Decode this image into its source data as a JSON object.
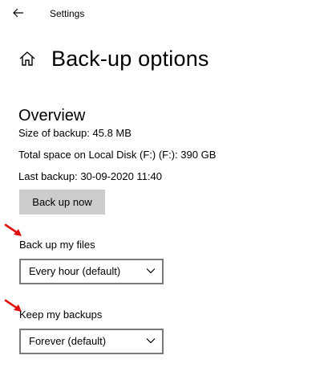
{
  "titlebar": {
    "app_title": "Settings",
    "back_icon": "arrow-left-icon"
  },
  "header": {
    "home_icon": "home-icon",
    "page_title": "Back-up options"
  },
  "overview": {
    "heading": "Overview",
    "size_of_backup": "Size of backup: 45.8 MB",
    "total_space": "Total space on Local Disk (F:) (F:): 390 GB",
    "last_backup": "Last backup: 30-09-2020 11:40",
    "back_up_now_label": "Back up now"
  },
  "backup_files": {
    "label": "Back up my files",
    "selected": "Every hour (default)"
  },
  "keep_backups": {
    "label": "Keep my backups",
    "selected": "Forever (default)"
  },
  "colors": {
    "button_bg": "#cccccc",
    "dropdown_border": "#7a7a7a",
    "annotation_arrow": "#e01010"
  }
}
